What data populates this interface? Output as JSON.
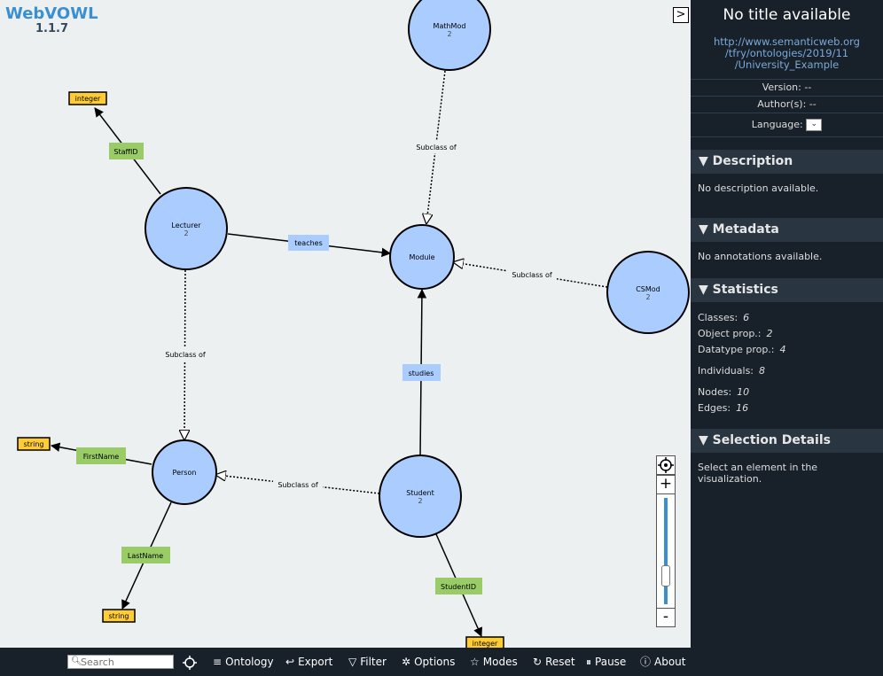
{
  "app": {
    "name": "WebVOWL",
    "version": "1.1.7"
  },
  "graph": {
    "classes": {
      "mathmod": {
        "label": "MathMod",
        "count": "2"
      },
      "lecturer": {
        "label": "Lecturer",
        "count": "2"
      },
      "module": {
        "label": "Module"
      },
      "csmod": {
        "label": "CSMod",
        "count": "2"
      },
      "person": {
        "label": "Person"
      },
      "student": {
        "label": "Student",
        "count": "2"
      }
    },
    "datatypes": {
      "integer_top": "integer",
      "string_left": "string",
      "string_bottom": "string",
      "integer_bottom": "integer"
    },
    "datatype_properties": {
      "staffid": "StaffID",
      "firstname": "FirstName",
      "lastname": "LastName",
      "studentid": "StudentID"
    },
    "object_properties": {
      "teaches": "teaches",
      "studies": "studies"
    },
    "subclass_label": "Subclass of"
  },
  "sidebar": {
    "title": "No title available",
    "iri_lines": [
      "http://www.semanticweb.org",
      "/tfry/ontologies/2019/11",
      "/University_Example"
    ],
    "version": "Version: --",
    "authors": "Author(s): --",
    "language": "Language:",
    "sections": {
      "description": {
        "title": "Description",
        "body": "No description available."
      },
      "metadata": {
        "title": "Metadata",
        "body": "No annotations available."
      },
      "statistics": {
        "title": "Statistics",
        "classes_label": "Classes:",
        "classes": "6",
        "objprop_label": "Object prop.:",
        "objprop": "2",
        "dataprop_label": "Datatype prop.:",
        "dataprop": "4",
        "individuals_label": "Individuals:",
        "individuals": "8",
        "nodes_label": "Nodes:",
        "nodes": "10",
        "edges_label": "Edges:",
        "edges": "16"
      },
      "selection": {
        "title": "Selection Details",
        "body": "Select an element in the visualization."
      }
    }
  },
  "toolbar": {
    "search_placeholder": "Search",
    "ontology": "Ontology",
    "export": "Export",
    "filter": "Filter",
    "options": "Options",
    "modes": "Modes",
    "reset": "Reset",
    "pause": "Pause",
    "about": "About"
  },
  "zoom": {
    "plus": "+",
    "minus": "-",
    "level": 0.2
  },
  "colors": {
    "class": "#aaccff",
    "datatype": "#ffcc33",
    "datatype_property": "#99cc66",
    "sidebar": "#18202a",
    "accent": "#3a8fd1"
  }
}
